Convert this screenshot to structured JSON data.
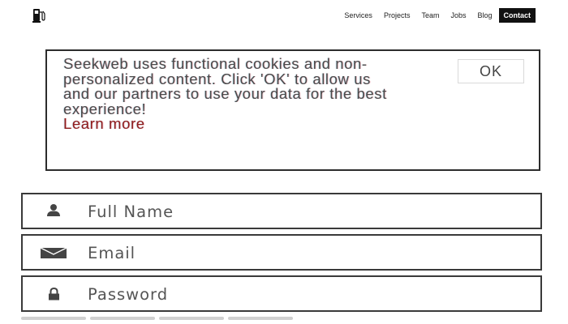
{
  "nav": {
    "items": [
      {
        "label": "Services"
      },
      {
        "label": "Projects"
      },
      {
        "label": "Team"
      },
      {
        "label": "Jobs"
      },
      {
        "label": "Blog"
      },
      {
        "label": "Contact",
        "active": true
      }
    ]
  },
  "cookie_notice": {
    "message": "Seekweb uses functional cookies and non-personalized content. Click 'OK' to allow us and our partners to use your data for the best experience!",
    "link_label": "Learn more",
    "ok_label": "OK"
  },
  "form": {
    "full_name_placeholder": "Full Name",
    "email_placeholder": "Email",
    "password_placeholder": "Password"
  },
  "icons": {
    "logo": "fuel-pump-icon",
    "full_name": "user-icon",
    "email": "envelope-icon",
    "password": "lock-icon"
  },
  "colors": {
    "active_nav_bg": "#111111",
    "link": "#8c1a1a",
    "border": "#3a3a3a"
  }
}
